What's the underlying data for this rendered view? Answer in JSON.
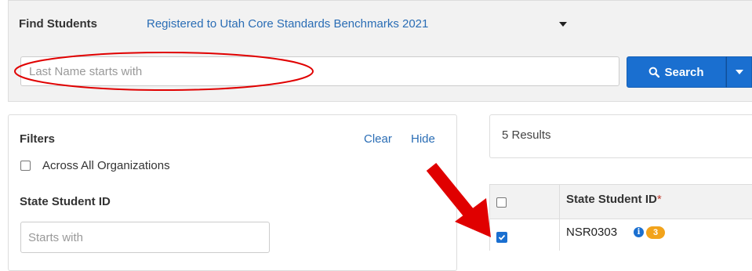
{
  "header": {
    "title": "Find Students",
    "registration_link": "Registered to Utah Core Standards Benchmarks 2021",
    "search_placeholder": "Last Name starts with",
    "search_button": "Search"
  },
  "filters": {
    "title": "Filters",
    "clear": "Clear",
    "hide": "Hide",
    "across_orgs_label": "Across All Organizations",
    "across_orgs_checked": false,
    "state_student_id_label": "State Student ID",
    "state_student_id_placeholder": "Starts with"
  },
  "results": {
    "count_text": "5 Results",
    "columns": [
      "State Student ID"
    ],
    "required_marker": "*",
    "rows": [
      {
        "checked": true,
        "state_student_id": "NSR0303",
        "badge": "3"
      }
    ]
  },
  "icons": [
    "search-icon",
    "caret-down-icon",
    "info-icon",
    "checkbox-icon"
  ],
  "colors": {
    "primary": "#1a6fd0",
    "link": "#2a6db5",
    "badge": "#f2a31b",
    "annotation": "#e00000"
  }
}
